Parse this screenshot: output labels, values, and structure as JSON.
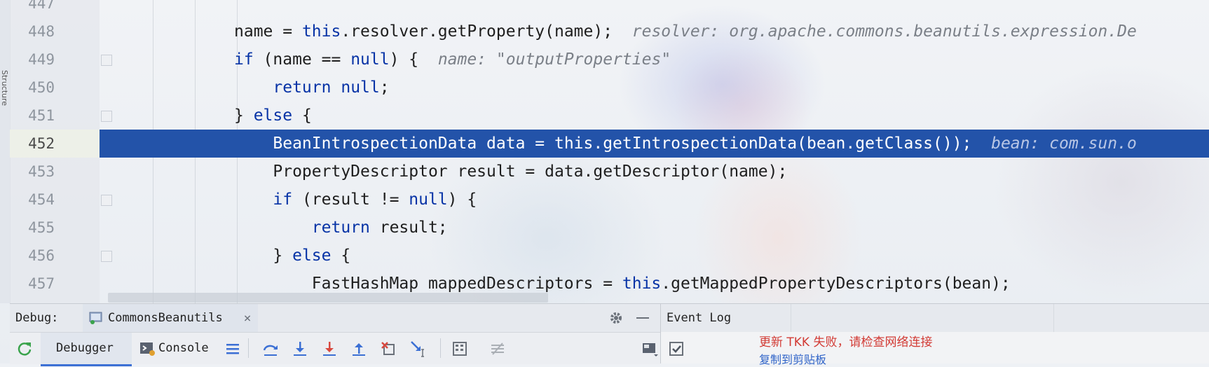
{
  "editor": {
    "lines": [
      {
        "num": "447",
        "segments": []
      },
      {
        "num": "448",
        "segments": [
          {
            "t": "name = ",
            "c": ""
          },
          {
            "t": "this",
            "c": "kw"
          },
          {
            "t": ".resolver.getProperty(name);  ",
            "c": ""
          },
          {
            "t": "resolver: org.apache.commons.beanutils.expression.De",
            "c": "hint"
          }
        ]
      },
      {
        "num": "449",
        "segments": [
          {
            "t": "if",
            "c": "kw"
          },
          {
            "t": " (name == ",
            "c": ""
          },
          {
            "t": "null",
            "c": "kw"
          },
          {
            "t": ") {  ",
            "c": ""
          },
          {
            "t": "name: \"outputProperties\"",
            "c": "hint"
          }
        ]
      },
      {
        "num": "450",
        "segments": [
          {
            "t": "    ",
            "c": ""
          },
          {
            "t": "return",
            "c": "kw"
          },
          {
            "t": " ",
            "c": ""
          },
          {
            "t": "null",
            "c": "kw"
          },
          {
            "t": ";",
            "c": ""
          }
        ]
      },
      {
        "num": "451",
        "segments": [
          {
            "t": "} ",
            "c": ""
          },
          {
            "t": "else",
            "c": "kw"
          },
          {
            "t": " {",
            "c": ""
          }
        ]
      },
      {
        "num": "452",
        "current": true,
        "segments": [
          {
            "t": "    BeanIntrospectionData data = ",
            "c": ""
          },
          {
            "t": "this",
            "c": "kw"
          },
          {
            "t": ".getIntrospectionData(bean.getClass());  ",
            "c": ""
          },
          {
            "t": "bean: com.sun.o",
            "c": "hint"
          }
        ]
      },
      {
        "num": "453",
        "segments": [
          {
            "t": "    PropertyDescriptor result = data.getDescriptor(name);",
            "c": ""
          }
        ]
      },
      {
        "num": "454",
        "segments": [
          {
            "t": "    ",
            "c": ""
          },
          {
            "t": "if",
            "c": "kw"
          },
          {
            "t": " (result != ",
            "c": ""
          },
          {
            "t": "null",
            "c": "kw"
          },
          {
            "t": ") {",
            "c": ""
          }
        ]
      },
      {
        "num": "455",
        "segments": [
          {
            "t": "        ",
            "c": ""
          },
          {
            "t": "return",
            "c": "kw"
          },
          {
            "t": " result;",
            "c": ""
          }
        ]
      },
      {
        "num": "456",
        "segments": [
          {
            "t": "    } ",
            "c": ""
          },
          {
            "t": "else",
            "c": "kw"
          },
          {
            "t": " {",
            "c": ""
          }
        ]
      },
      {
        "num": "457",
        "segments": [
          {
            "t": "        FastHashMap mappedDescriptors = ",
            "c": ""
          },
          {
            "t": "this",
            "c": "kw"
          },
          {
            "t": ".getMappedPropertyDescriptors(bean);",
            "c": ""
          }
        ]
      }
    ]
  },
  "debug_panel": {
    "label": "Debug:",
    "run_tab": "CommonsBeanutils",
    "tabs": {
      "debugger": "Debugger",
      "console": "Console"
    }
  },
  "event_log": {
    "title": "Event Log",
    "message": "更新 TKK 失败，请检查网络连接",
    "link": "复制到剪贴板"
  },
  "colors": {
    "current_line": "#2353a9",
    "keyword": "#0733a6",
    "error_text": "#d23a34",
    "link": "#2f63c8"
  }
}
